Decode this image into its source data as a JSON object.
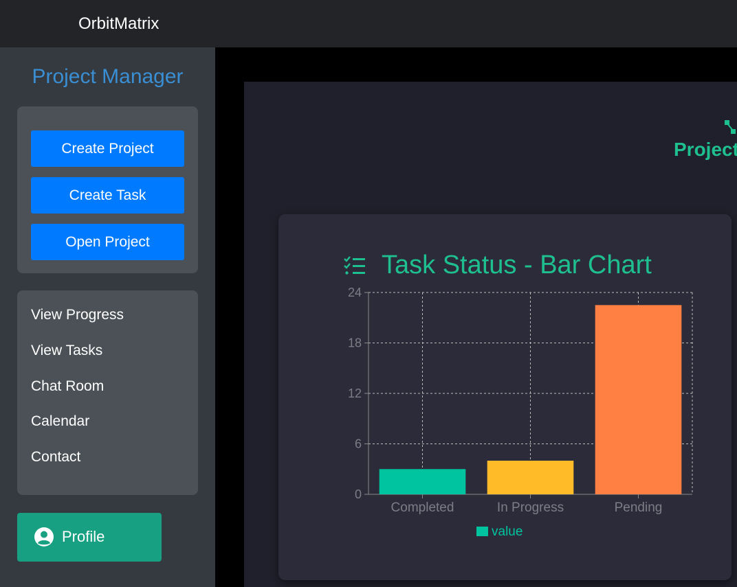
{
  "app": {
    "brand": "OrbitMatrix"
  },
  "sidebar": {
    "title": "Project Manager",
    "actions": [
      {
        "label": "Create Project"
      },
      {
        "label": "Create Task"
      },
      {
        "label": "Open Project"
      }
    ],
    "nav": [
      {
        "label": "View Progress"
      },
      {
        "label": "View Tasks"
      },
      {
        "label": "Chat Room"
      },
      {
        "label": "Calendar"
      },
      {
        "label": "Contact"
      }
    ],
    "profile": {
      "label": "Profile",
      "icon": "user-circle-icon"
    }
  },
  "main": {
    "project_label": "Project",
    "project_icon": "network-icon",
    "chart_card": {
      "title": "Task Status - Bar Chart",
      "icon": "checklist-icon"
    }
  },
  "chart_data": {
    "type": "bar",
    "title": "Task Status - Bar Chart",
    "categories": [
      "Completed",
      "In Progress",
      "Pending"
    ],
    "series": [
      {
        "name": "value",
        "values": [
          3,
          4,
          22.5
        ]
      }
    ],
    "bar_colors": [
      "#00c49f",
      "#ffbb28",
      "#ff8042"
    ],
    "legend_color": "#00c49f",
    "ylim": [
      0,
      24
    ],
    "yticks": [
      0,
      6,
      12,
      18,
      24
    ],
    "grid": true,
    "legend": "bottom",
    "xlabel": "",
    "ylabel": ""
  },
  "colors": {
    "accent": "#1fc090",
    "button": "#007bff",
    "sidebar_title": "#3a8fd4",
    "profile": "#17a081"
  }
}
